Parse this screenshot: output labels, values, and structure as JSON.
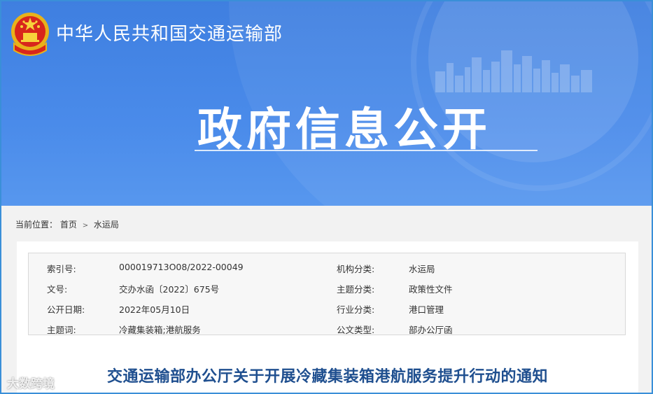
{
  "header": {
    "ministry_name": "中华人民共和国交通运输部",
    "section_title": "政府信息公开"
  },
  "breadcrumb": {
    "prefix": "当前位置：",
    "items": [
      "首页",
      "水运局"
    ],
    "separator": ">"
  },
  "metadata": [
    {
      "label": "索引号:",
      "value": "000019713O08/2022-00049",
      "label2": "机构分类:",
      "value2": "水运局"
    },
    {
      "label": "文号:",
      "value": "交办水函〔2022〕675号",
      "label2": "主题分类:",
      "value2": "政策性文件"
    },
    {
      "label": "公开日期:",
      "value": "2022年05月10日",
      "label2": "行业分类:",
      "value2": "港口管理"
    },
    {
      "label": "主题词:",
      "value": "冷藏集装箱;港航服务",
      "label2": "公文类型:",
      "value2": "部办公厅函"
    }
  ],
  "document": {
    "title": "交通运输部办公厅关于开展冷藏集装箱港航服务提升行动的通知"
  },
  "watermark": "大数跨境",
  "colors": {
    "banner": "#4a8bea",
    "title_text": "#1f4f8f",
    "frame_border": "#3a8fd8"
  }
}
